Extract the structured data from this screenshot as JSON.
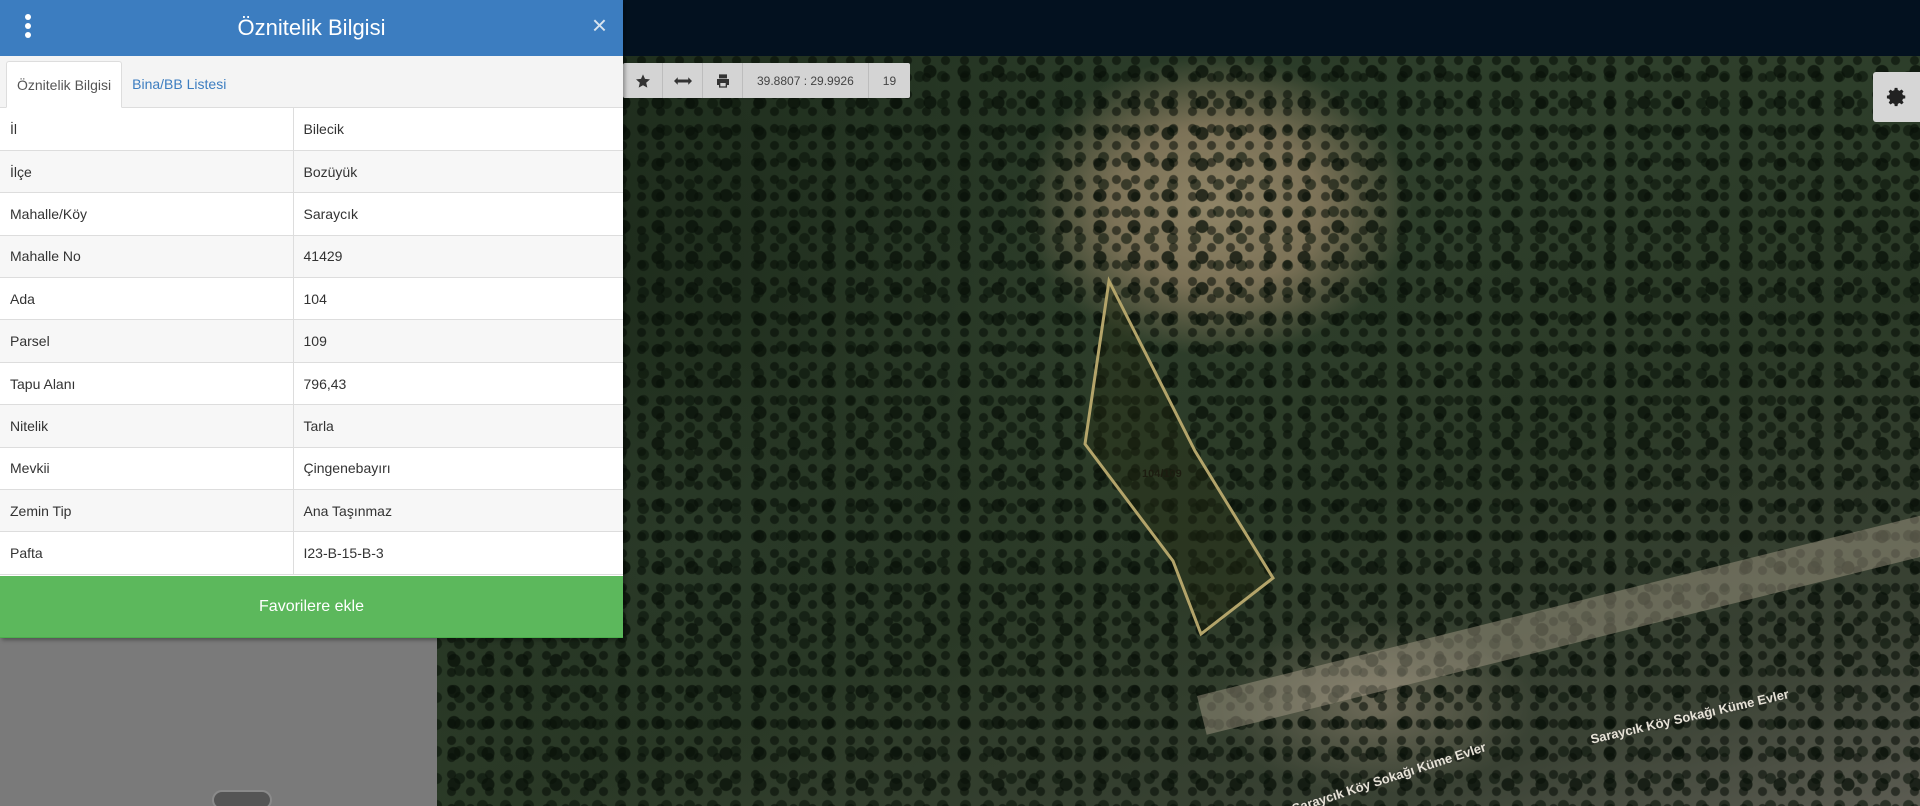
{
  "panel": {
    "title": "Öznitelik Bilgisi",
    "menu_icon": "vertical-ellipsis-icon",
    "close_icon": "close-icon",
    "close_glyph": "×",
    "tabs": [
      {
        "label": "Öznitelik Bilgisi",
        "active": true
      },
      {
        "label": "Bina/BB Listesi",
        "active": false
      }
    ],
    "rows": [
      {
        "key": "İl",
        "value": "Bilecik"
      },
      {
        "key": "İlçe",
        "value": "Bozüyük"
      },
      {
        "key": "Mahalle/Köy",
        "value": "Saraycık"
      },
      {
        "key": "Mahalle No",
        "value": "41429"
      },
      {
        "key": "Ada",
        "value": "104"
      },
      {
        "key": "Parsel",
        "value": "109"
      },
      {
        "key": "Tapu Alanı",
        "value": "796,43"
      },
      {
        "key": "Nitelik",
        "value": "Tarla"
      },
      {
        "key": "Mevkii",
        "value": "Çingenebayırı"
      },
      {
        "key": "Zemin Tip",
        "value": "Ana Taşınmaz"
      },
      {
        "key": "Pafta",
        "value": "I23-B-15-B-3"
      }
    ],
    "favorite_button": "Favorilere ekle",
    "accent_color": "#3c7dc0",
    "button_color": "#5cb85c"
  },
  "toolbar": {
    "icons": [
      "star-icon",
      "measure-icon",
      "print-icon"
    ],
    "coordinates": "39.8807 : 29.9926",
    "zoom": "19"
  },
  "map": {
    "parcel_label": "104/109",
    "street_label_1": "Saraycık Köy Sokağı Küme Evler",
    "street_label_2": "Saraycık Köy Sokağı Küme Evler",
    "settings_icon": "gear-icon"
  }
}
